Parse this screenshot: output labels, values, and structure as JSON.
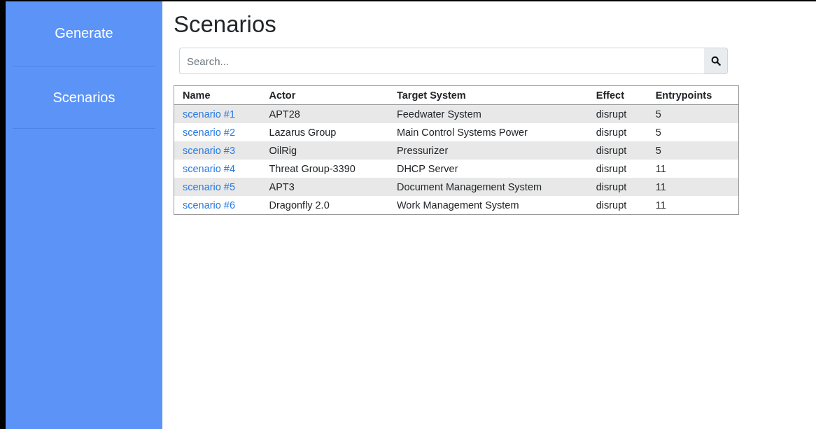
{
  "sidebar": {
    "items": [
      {
        "label": "Generate"
      },
      {
        "label": "Scenarios"
      }
    ]
  },
  "page_title": "Scenarios",
  "search": {
    "placeholder": "Search..."
  },
  "table": {
    "columns": [
      "Name",
      "Actor",
      "Target System",
      "Effect",
      "Entrypoints"
    ],
    "rows": [
      {
        "name": "scenario #1",
        "actor": "APT28",
        "target_system": "Feedwater System",
        "effect": "disrupt",
        "entrypoints": "5"
      },
      {
        "name": "scenario #2",
        "actor": "Lazarus Group",
        "target_system": "Main Control Systems Power",
        "effect": "disrupt",
        "entrypoints": "5"
      },
      {
        "name": "scenario #3",
        "actor": "OilRig",
        "target_system": "Pressurizer",
        "effect": "disrupt",
        "entrypoints": "5"
      },
      {
        "name": "scenario #4",
        "actor": "Threat Group-3390",
        "target_system": "DHCP Server",
        "effect": "disrupt",
        "entrypoints": "11"
      },
      {
        "name": "scenario #5",
        "actor": "APT3",
        "target_system": "Document Management System",
        "effect": "disrupt",
        "entrypoints": "11"
      },
      {
        "name": "scenario #6",
        "actor": "Dragonfly 2.0",
        "target_system": "Work Management System",
        "effect": "disrupt",
        "entrypoints": "11"
      }
    ]
  }
}
